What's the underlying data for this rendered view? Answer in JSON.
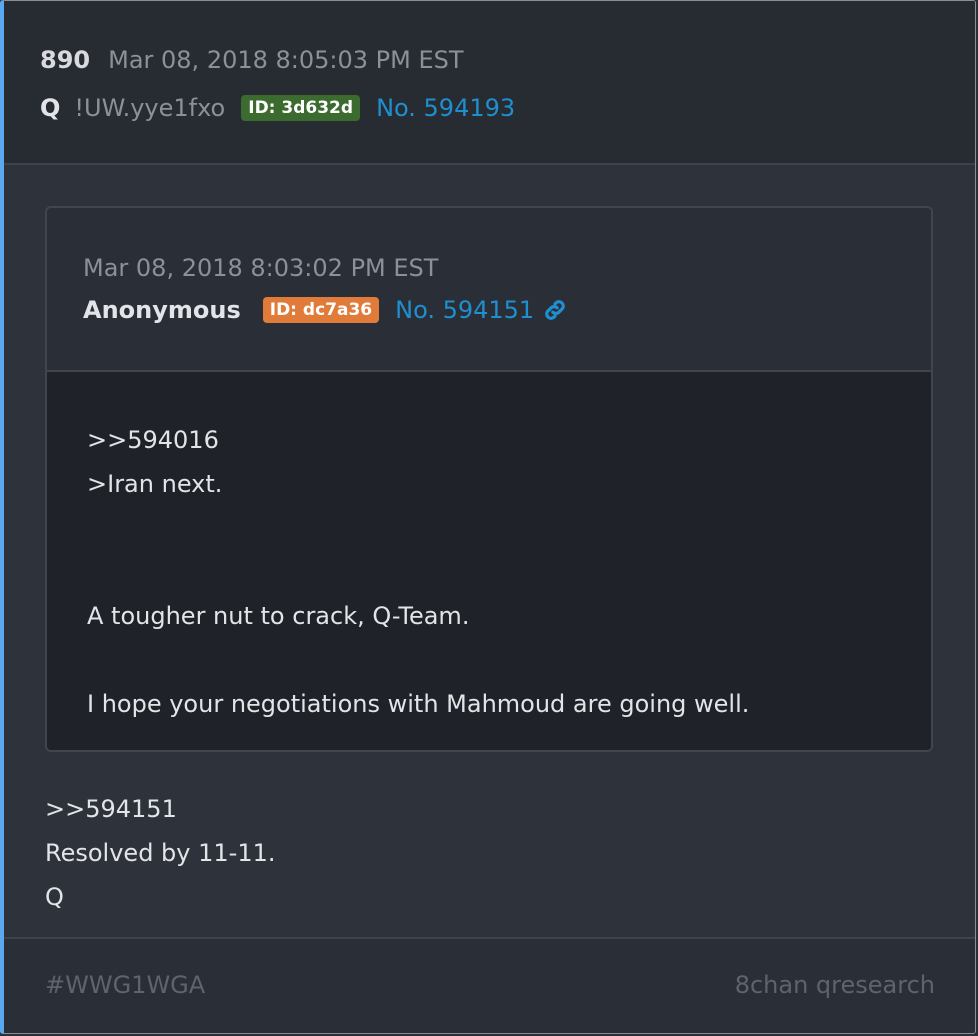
{
  "post": {
    "number": "890",
    "date": "Mar 08, 2018 8:05:03 PM EST",
    "author": "Q",
    "tripcode": "!UW.yye1fxo",
    "id_badge": "ID: 3d632d",
    "post_link": "No. 594193",
    "body_lines": [
      ">>594151",
      "Resolved by 11-11.",
      "Q"
    ]
  },
  "quoted_post": {
    "date": "Mar 08, 2018 8:03:02 PM EST",
    "author": "Anonymous",
    "id_badge": "ID: dc7a36",
    "post_link": "No. 594151",
    "link_icon": "chain-link-icon",
    "body_lines": [
      ">>594016",
      ">Iran next.",
      "",
      "",
      "A tougher nut to crack, Q-Team.",
      "",
      "I hope your negotiations with Mahmoud are going well."
    ]
  },
  "footer": {
    "hashtag": "#WWG1WGA",
    "source": "8chan qresearch"
  },
  "colors": {
    "accent_border": "#5aa8f0",
    "link": "#1f8fd0",
    "id_green": "#3b6b2e",
    "id_orange": "#e07b39"
  }
}
